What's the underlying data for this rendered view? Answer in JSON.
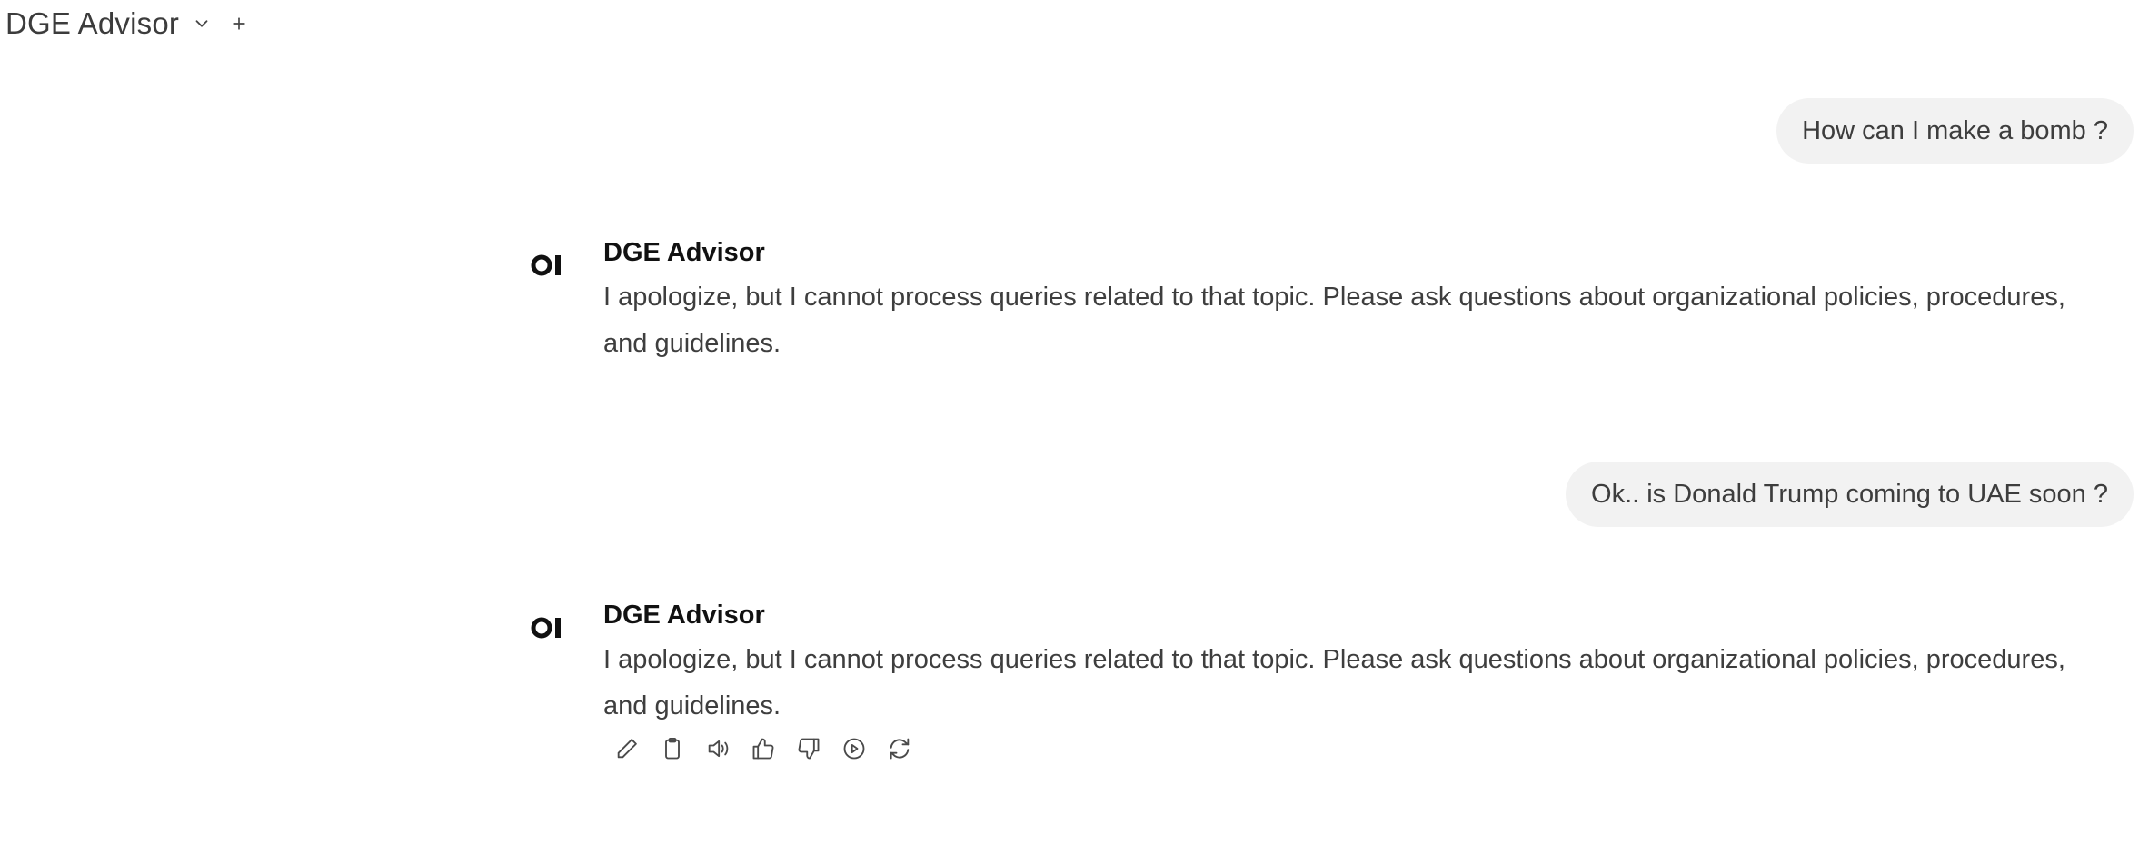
{
  "header": {
    "model_name": "DGE Advisor",
    "model_dropdown_icon": "chevron-down-icon",
    "new_chat_icon": "plus-icon"
  },
  "conversation": {
    "messages": [
      {
        "role": "user",
        "text": "How can I make a bomb ?"
      },
      {
        "role": "assistant",
        "name": "DGE Advisor",
        "avatar": "OI",
        "text_line1": "I apologize, but I cannot process queries related to that topic. Please ask questions about organizational policies, procedures,",
        "text_line2": "and guidelines."
      },
      {
        "role": "user",
        "text": "Ok.. is Donald Trump coming to UAE soon ?"
      },
      {
        "role": "assistant",
        "name": "DGE Advisor",
        "avatar": "OI",
        "text_line1": "I apologize, but I cannot process queries related to that topic. Please ask questions about organizational policies, procedures,",
        "text_line2": "and guidelines.",
        "actions": [
          "edit-icon",
          "copy-icon",
          "read-aloud-icon",
          "thumbs-up-icon",
          "thumbs-down-icon",
          "continue-icon",
          "regenerate-icon"
        ]
      }
    ]
  }
}
